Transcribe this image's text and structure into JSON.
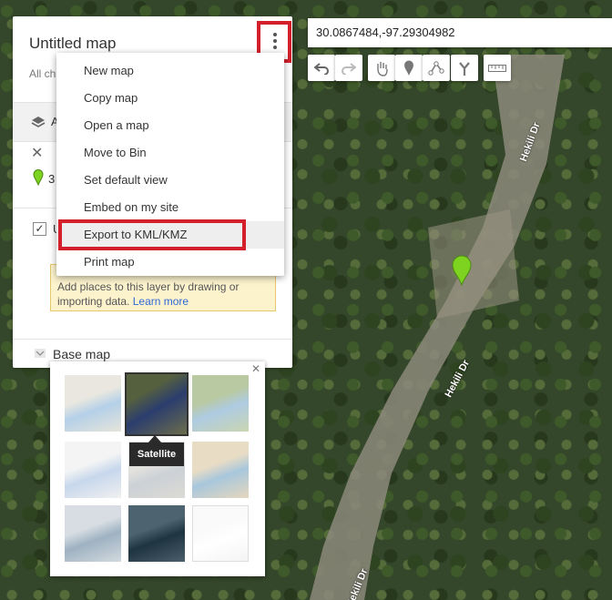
{
  "map": {
    "title": "Untitled map",
    "all_changes_prefix": "All ch",
    "layer_prefix": "A",
    "count_prefix": "3",
    "layer_name_prefix": "U",
    "basemap_label": "Base map",
    "empty_note_text": "Add places to this layer by drawing or importing data.",
    "learn_more": "Learn more"
  },
  "menu": {
    "items": [
      "New map",
      "Copy map",
      "Open a map",
      "Move to Bin",
      "Set default view",
      "Embed on my site",
      "Export to KML/KMZ",
      "Print map"
    ],
    "highlighted_index": 6
  },
  "search": {
    "value": "30.0867484,-97.29304982"
  },
  "toolbar": {
    "tools": [
      "undo-icon",
      "redo-icon",
      "hand-icon",
      "marker-icon",
      "draw-line-icon",
      "directions-icon",
      "ruler-icon"
    ]
  },
  "basemap": {
    "selected_tooltip": "Satellite"
  },
  "road_labels": [
    "Hekili Dr",
    "Hekili Dr",
    "Hekili Dr"
  ],
  "colors": {
    "highlight_box": "#d3202a",
    "marker": "#7ed321",
    "note_bg": "#fcf3cd",
    "link": "#3367d6"
  }
}
